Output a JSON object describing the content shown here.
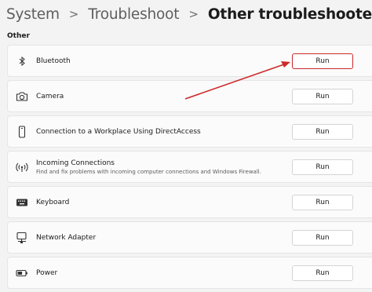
{
  "breadcrumb": {
    "items": [
      "System",
      "Troubleshoot",
      "Other troubleshooters"
    ],
    "separator": ">"
  },
  "section": {
    "label": "Other"
  },
  "troubleshooters": [
    {
      "title": "Bluetooth",
      "description": "",
      "button": "Run",
      "icon": "bluetooth-icon"
    },
    {
      "title": "Camera",
      "description": "",
      "button": "Run",
      "icon": "camera-icon"
    },
    {
      "title": "Connection to a Workplace Using DirectAccess",
      "description": "",
      "button": "Run",
      "icon": "phone-device-icon"
    },
    {
      "title": "Incoming Connections",
      "description": "Find and fix problems with incoming computer connections and Windows Firewall.",
      "button": "Run",
      "icon": "wireless-signal-icon"
    },
    {
      "title": "Keyboard",
      "description": "",
      "button": "Run",
      "icon": "keyboard-icon"
    },
    {
      "title": "Network Adapter",
      "description": "",
      "button": "Run",
      "icon": "network-adapter-icon"
    },
    {
      "title": "Power",
      "description": "",
      "button": "Run",
      "icon": "battery-icon"
    }
  ],
  "annotation": {
    "color": "#cc2a2a",
    "highlighted_button": "Bluetooth Run"
  }
}
